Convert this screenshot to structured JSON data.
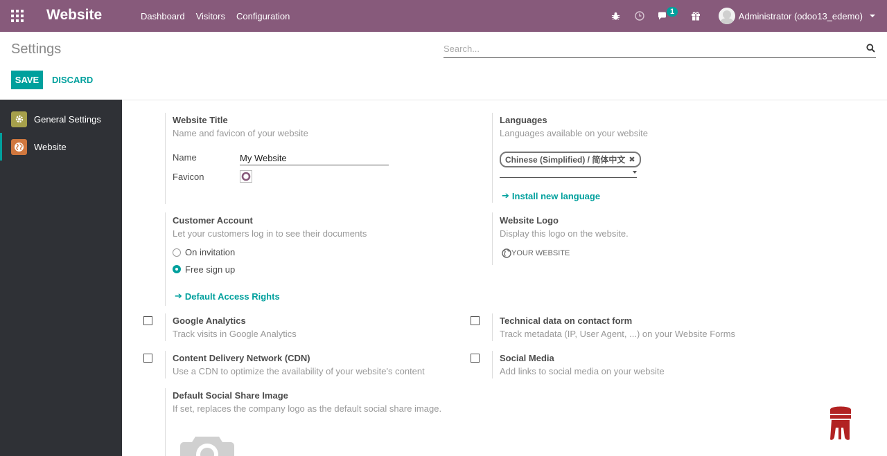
{
  "navbar": {
    "brand": "Website",
    "menu": [
      "Dashboard",
      "Visitors",
      "Configuration"
    ],
    "messages_badge": "1",
    "user_name": "Administrator (odoo13_edemo)",
    "color": "#875a7b"
  },
  "control_panel": {
    "title": "Settings",
    "search_placeholder": "Search...",
    "save_label": "SAVE",
    "discard_label": "DISCARD"
  },
  "sidebar": {
    "items": [
      {
        "label": "General Settings",
        "icon": "gear-icon",
        "active": false
      },
      {
        "label": "Website",
        "icon": "globe-icon",
        "active": true
      }
    ]
  },
  "settings": {
    "website_title": {
      "title": "Website Title",
      "description": "Name and favicon of your website",
      "name_label": "Name",
      "name_value": "My Website",
      "favicon_label": "Favicon"
    },
    "languages": {
      "title": "Languages",
      "description": "Languages available on your website",
      "tag": "Chinese (Simplified) / 简体中文",
      "install_link": "Install new language"
    },
    "customer_account": {
      "title": "Customer Account",
      "description": "Let your customers log in to see their documents",
      "option_invitation": "On invitation",
      "option_signup": "Free sign up",
      "selected": "Free sign up",
      "access_link": "Default Access Rights"
    },
    "website_logo": {
      "title": "Website Logo",
      "description": "Display this logo on the website.",
      "logo_text": "YOUR WEBSITE"
    },
    "google_analytics": {
      "title": "Google Analytics",
      "description": "Track visits in Google Analytics",
      "checked": false
    },
    "technical_data": {
      "title": "Technical data on contact form",
      "description": "Track metadata (IP, User Agent, ...) on your Website Forms",
      "checked": false
    },
    "cdn": {
      "title": "Content Delivery Network (CDN)",
      "description": "Use a CDN to optimize the availability of your website's content",
      "checked": false
    },
    "social_media": {
      "title": "Social Media",
      "description": "Add links to social media on your website",
      "checked": false
    },
    "social_share": {
      "title": "Default Social Share Image",
      "description": "If set, replaces the company logo as the default social share image."
    }
  },
  "colors": {
    "accent": "#00a09d",
    "sidebar_bg": "#2f3136"
  }
}
